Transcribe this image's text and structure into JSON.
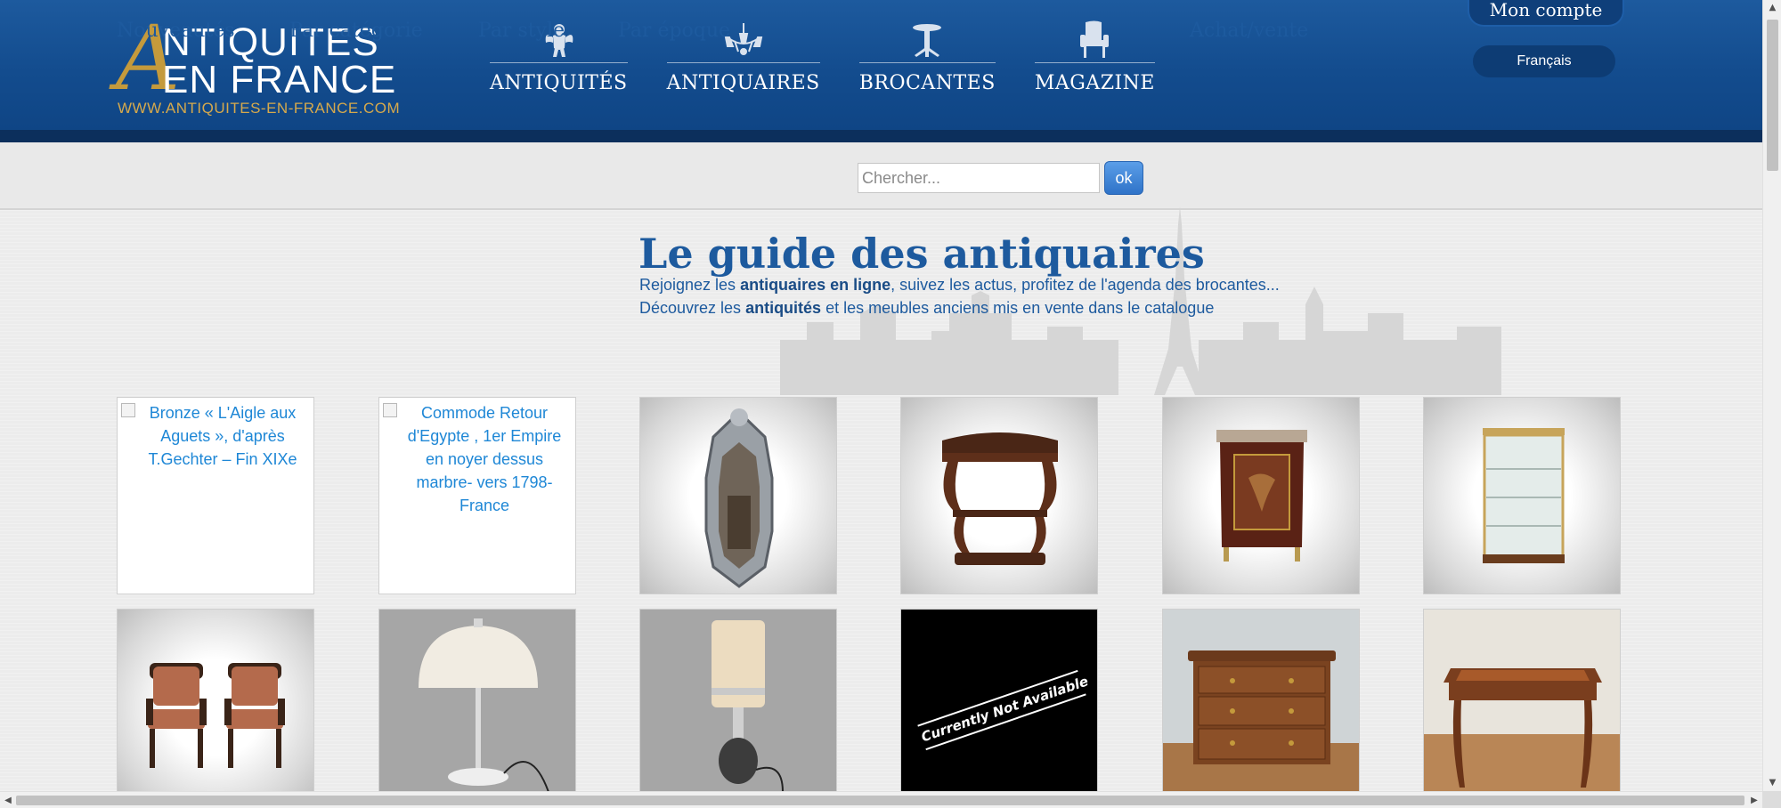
{
  "header": {
    "logo": {
      "line1": "NTIQUITES",
      "line2": "EN FRANCE",
      "initial": "A",
      "url": "WWW.ANTIQUITES-EN-FRANCE.COM"
    },
    "nav": [
      {
        "label": "ANTIQUITÉS",
        "icon": "cherub-icon"
      },
      {
        "label": "ANTIQUAIRES",
        "icon": "chandelier-icon"
      },
      {
        "label": "BROCANTES",
        "icon": "pedestal-table-icon"
      },
      {
        "label": "MAGAZINE",
        "icon": "armchair-icon"
      }
    ],
    "account_label": "Mon compte",
    "language_label": "Français"
  },
  "subnav": {
    "links": [
      "Nouveautés",
      "Par catégorie",
      "Par style",
      "Par époque"
    ],
    "search_placeholder": "Chercher...",
    "search_button": "ok",
    "buy_sell": "Achat/vente"
  },
  "hero": {
    "title": "Le guide des antiquaires",
    "line1_a": "Rejoignez les ",
    "line1_b": "antiquaires en ligne",
    "line1_c": ", suivez les actus, profitez de l'agenda des brocantes...",
    "line2_a": "Découvrez les ",
    "line2_b": "antiquités",
    "line2_c": " et les meubles anciens mis en vente dans le catalogue"
  },
  "products": [
    {
      "alt": "Bronze « L'Aigle aux Aguets », d'après T.Gechter – Fin XIXe",
      "image": "broken"
    },
    {
      "alt": "Commode Retour d'Egypte , 1er Empire en noyer dessus marbre- vers 1798- France",
      "image": "broken"
    },
    {
      "image": "venetian-mirror"
    },
    {
      "image": "wall-shelf"
    },
    {
      "image": "marquetry-cabinet"
    },
    {
      "image": "glass-vitrine"
    },
    {
      "image": "pair-of-armchairs"
    },
    {
      "image": "mushroom-floor-lamp"
    },
    {
      "image": "cylinder-table-lamp"
    },
    {
      "image": "not-available",
      "caption": "Currently Not Available"
    },
    {
      "image": "walnut-commode"
    },
    {
      "image": "leather-top-desk"
    }
  ],
  "colors": {
    "header_blue": "#134c8e",
    "link_blue": "#1d5a9e",
    "logo_gold": "#c49a3c"
  }
}
